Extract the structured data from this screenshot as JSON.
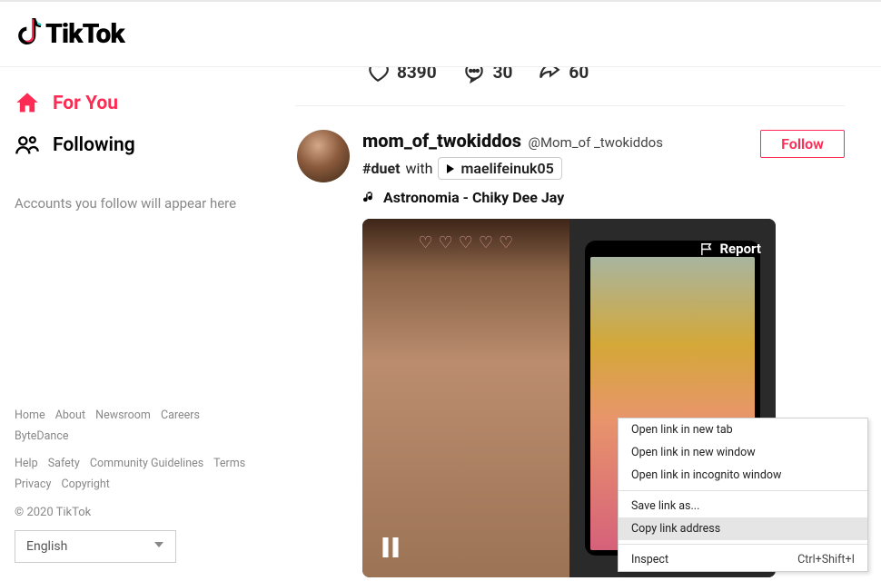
{
  "brand": "TikTok",
  "sidebar": {
    "nav": [
      {
        "label": "For You",
        "active": true
      },
      {
        "label": "Following",
        "active": false
      }
    ],
    "hint": "Accounts you follow will appear here"
  },
  "footer": {
    "links_row1": [
      "Home",
      "About",
      "Newsroom",
      "Careers",
      "ByteDance"
    ],
    "links_row2": [
      "Help",
      "Safety",
      "Community Guidelines",
      "Terms",
      "Privacy",
      "Copyright"
    ],
    "copyright": "© 2020 TikTok",
    "language": "English"
  },
  "prev_post": {
    "likes": "8390",
    "comments": "30",
    "shares": "60"
  },
  "post": {
    "username": "mom_of_twokiddos",
    "handle": "@Mom_of _twokiddos",
    "caption_hashtag": "#duet",
    "caption_with": "with",
    "referenced_user": "maelifeinuk05",
    "music": "Astronomia - Chiky Dee Jay",
    "follow_label": "Follow",
    "report_label": "Report"
  },
  "context_menu": {
    "items": [
      {
        "label": "Open link in new tab",
        "type": "item"
      },
      {
        "label": "Open link in new window",
        "type": "item"
      },
      {
        "label": "Open link in incognito window",
        "type": "item"
      },
      {
        "type": "sep"
      },
      {
        "label": "Save link as...",
        "type": "item"
      },
      {
        "label": "Copy link address",
        "type": "item",
        "highlighted": true
      },
      {
        "type": "sep"
      },
      {
        "label": "Inspect",
        "type": "item",
        "shortcut": "Ctrl+Shift+I"
      }
    ]
  }
}
